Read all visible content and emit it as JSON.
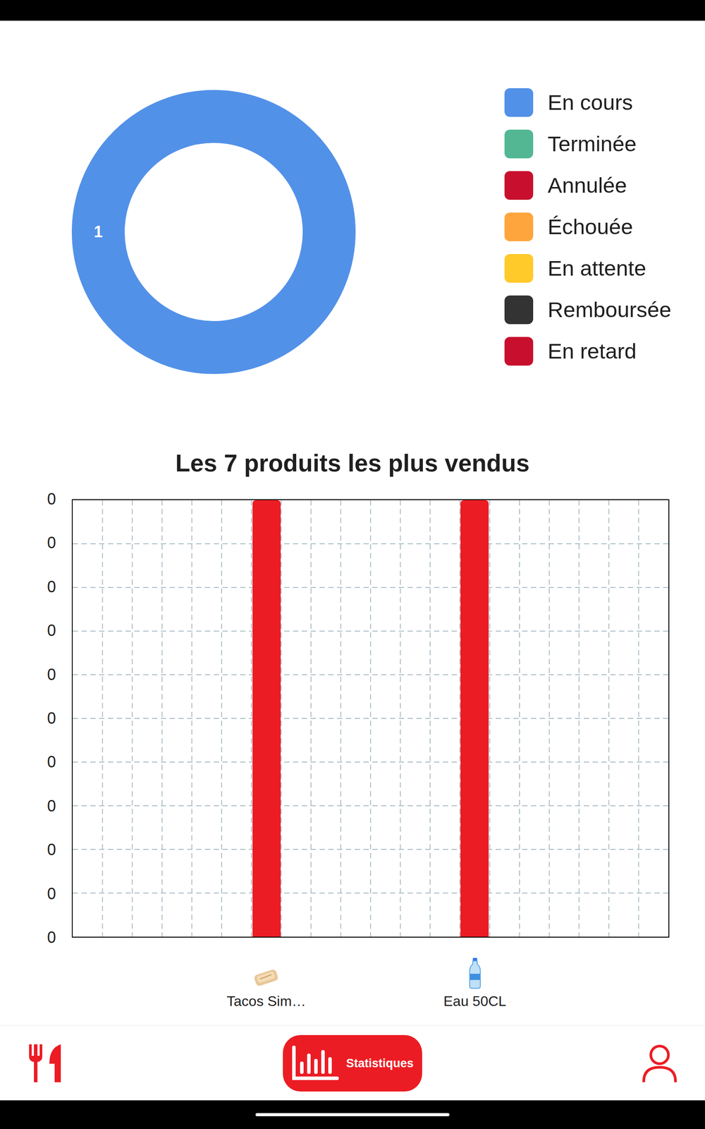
{
  "donut": {
    "segments": [
      {
        "status": "En cours",
        "value": 1,
        "label": "1",
        "color": "#5291E8"
      }
    ]
  },
  "legend": [
    {
      "label": "En cours",
      "color": "#5291E8"
    },
    {
      "label": "Terminée",
      "color": "#52B792"
    },
    {
      "label": "Annulée",
      "color": "#C8102E"
    },
    {
      "label": "Échouée",
      "color": "#FFA53D"
    },
    {
      "label": "En attente",
      "color": "#FFCA2A"
    },
    {
      "label": "Remboursée",
      "color": "#333333"
    },
    {
      "label": "En retard",
      "color": "#C8102E"
    }
  ],
  "chart": {
    "title": "Les 7 produits les plus vendus",
    "y_ticks": [
      "0",
      "0",
      "0",
      "0",
      "0",
      "0",
      "0",
      "0",
      "0",
      "0",
      "0"
    ],
    "products": [
      {
        "label": "Tacos Sim…",
        "value": 1
      },
      {
        "label": "Eau 50CL",
        "value": 1
      }
    ]
  },
  "nav": {
    "items": [
      {
        "selected": false
      },
      {
        "label": "Statistiques",
        "selected": true
      },
      {
        "selected": false
      }
    ]
  }
}
